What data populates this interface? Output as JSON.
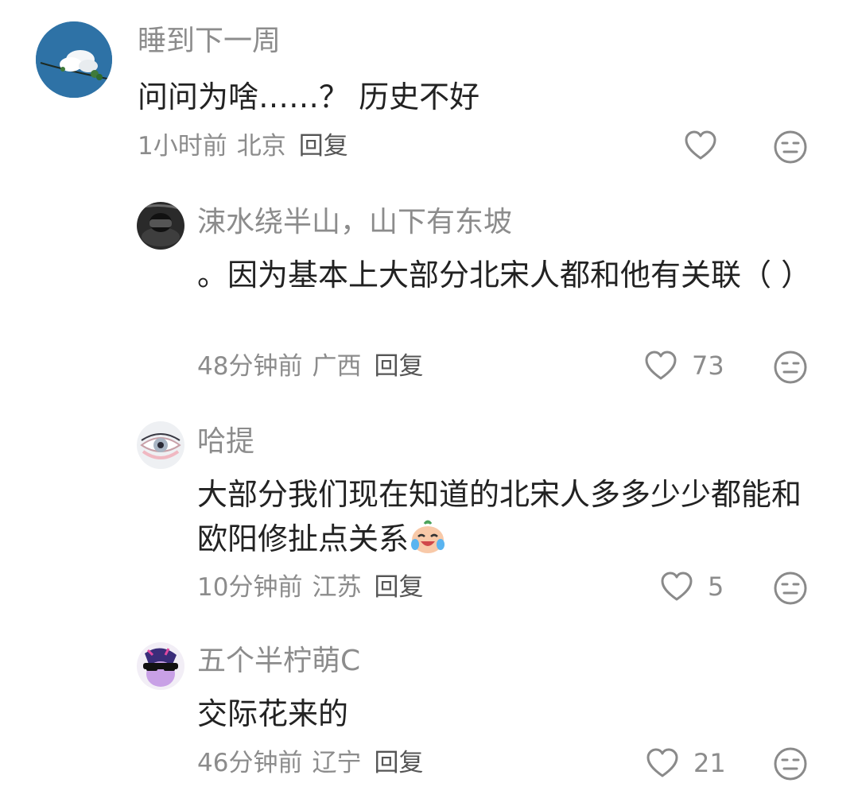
{
  "comments": [
    {
      "username": "睡到下一周",
      "content": "问问为啥……？ 历史不好",
      "time": "1小时前",
      "location": "北京",
      "reply_label": "回复",
      "likes": "",
      "avatar_icon": "cloud-sky-avatar"
    },
    {
      "username": "涑水绕半山，山下有东坡",
      "content": "。因为基本上大部分北宋人都和他有关联（ ）",
      "time": "48分钟前",
      "location": "广西",
      "reply_label": "回复",
      "likes": "73",
      "avatar_icon": "dark-portrait-avatar"
    },
    {
      "username": "哈提",
      "content": "大部分我们现在知道的北宋人多多少少都能和欧阳修扯点关系",
      "time": "10分钟前",
      "location": "江苏",
      "reply_label": "回复",
      "likes": "5",
      "avatar_icon": "eye-closeup-avatar",
      "inline_emoji": "laugh-cry-emoji"
    },
    {
      "username": "五个半柠萌C",
      "content": "交际花来的",
      "time": "46分钟前",
      "location": "辽宁",
      "reply_label": "回复",
      "likes": "21",
      "avatar_icon": "pony-sunglasses-avatar"
    }
  ],
  "colors": {
    "text_primary": "#222222",
    "text_secondary": "#8c8c8c",
    "icon_stroke": "#8a8a8a"
  }
}
